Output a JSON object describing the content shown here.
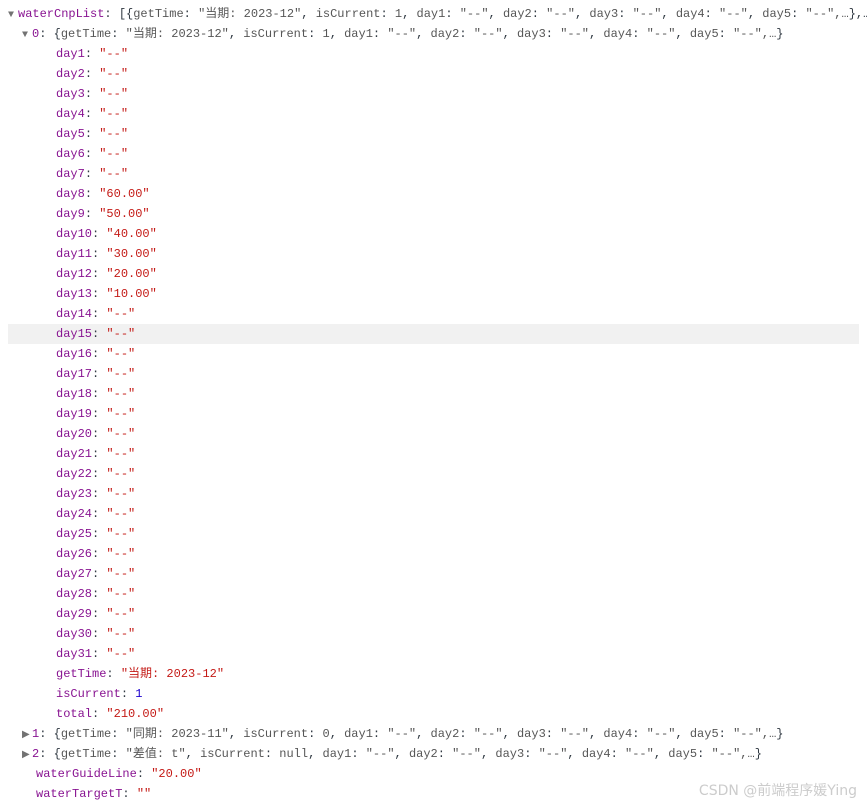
{
  "root": {
    "name": "waterCnpList",
    "preview_items": [
      "getTime: \"当期: 2023-12\"",
      "isCurrent: 1",
      "day1: \"--\"",
      "day2: \"--\"",
      "day3: \"--\"",
      "day4: \"--\"",
      "day5: \"--\",…"
    ]
  },
  "item0": {
    "index": "0",
    "preview_items": [
      "getTime: \"当期: 2023-12\"",
      "isCurrent: 1",
      "day1: \"--\"",
      "day2: \"--\"",
      "day3: \"--\"",
      "day4: \"--\"",
      "day5: \"--\",…"
    ],
    "days": [
      {
        "k": "day1",
        "v": "\"--\""
      },
      {
        "k": "day2",
        "v": "\"--\""
      },
      {
        "k": "day3",
        "v": "\"--\""
      },
      {
        "k": "day4",
        "v": "\"--\""
      },
      {
        "k": "day5",
        "v": "\"--\""
      },
      {
        "k": "day6",
        "v": "\"--\""
      },
      {
        "k": "day7",
        "v": "\"--\""
      },
      {
        "k": "day8",
        "v": "\"60.00\""
      },
      {
        "k": "day9",
        "v": "\"50.00\""
      },
      {
        "k": "day10",
        "v": "\"40.00\""
      },
      {
        "k": "day11",
        "v": "\"30.00\""
      },
      {
        "k": "day12",
        "v": "\"20.00\""
      },
      {
        "k": "day13",
        "v": "\"10.00\""
      },
      {
        "k": "day14",
        "v": "\"--\""
      },
      {
        "k": "day15",
        "v": "\"--\""
      },
      {
        "k": "day16",
        "v": "\"--\""
      },
      {
        "k": "day17",
        "v": "\"--\""
      },
      {
        "k": "day18",
        "v": "\"--\""
      },
      {
        "k": "day19",
        "v": "\"--\""
      },
      {
        "k": "day20",
        "v": "\"--\""
      },
      {
        "k": "day21",
        "v": "\"--\""
      },
      {
        "k": "day22",
        "v": "\"--\""
      },
      {
        "k": "day23",
        "v": "\"--\""
      },
      {
        "k": "day24",
        "v": "\"--\""
      },
      {
        "k": "day25",
        "v": "\"--\""
      },
      {
        "k": "day26",
        "v": "\"--\""
      },
      {
        "k": "day27",
        "v": "\"--\""
      },
      {
        "k": "day28",
        "v": "\"--\""
      },
      {
        "k": "day29",
        "v": "\"--\""
      },
      {
        "k": "day30",
        "v": "\"--\""
      },
      {
        "k": "day31",
        "v": "\"--\""
      }
    ],
    "getTime": "\"当期: 2023-12\"",
    "isCurrent": "1",
    "total": "\"210.00\""
  },
  "item1": {
    "index": "1",
    "preview_items": [
      "getTime: \"同期: 2023-11\"",
      "isCurrent: 0",
      "day1: \"--\"",
      "day2: \"--\"",
      "day3: \"--\"",
      "day4: \"--\"",
      "day5: \"--\",…"
    ]
  },
  "item2": {
    "index": "2",
    "preview_items": [
      "getTime: \"差值: t\"",
      "isCurrent: null",
      "day1: \"--\"",
      "day2: \"--\"",
      "day3: \"--\"",
      "day4: \"--\"",
      "day5: \"--\",…"
    ]
  },
  "waterGuideLine": "\"20.00\"",
  "waterTargetT": "\"\"",
  "highlightKey": "day15",
  "labels": {
    "getTime": "getTime",
    "isCurrent": "isCurrent",
    "total": "total",
    "waterGuideLine": "waterGuideLine",
    "waterTargetT": "waterTargetT"
  },
  "watermark": "CSDN @前端程序媛Ying"
}
